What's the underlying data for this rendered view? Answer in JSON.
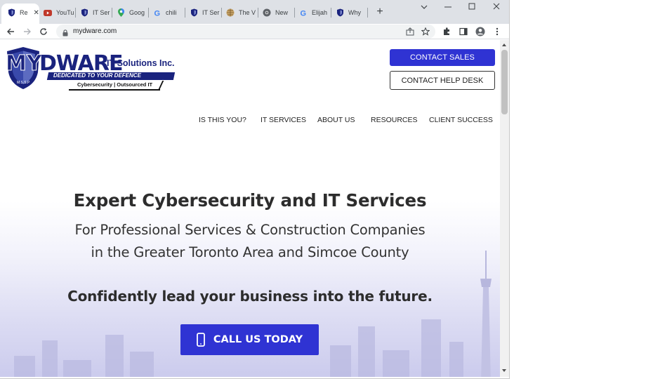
{
  "browser": {
    "tabs": [
      {
        "label": "Re",
        "icon": "shield-favicon"
      },
      {
        "label": "YouTu",
        "icon": "youtube-favicon"
      },
      {
        "label": "IT Ser",
        "icon": "shield-favicon"
      },
      {
        "label": "Goog",
        "icon": "maps-pin-favicon"
      },
      {
        "label": "chili",
        "icon": "google-g-favicon"
      },
      {
        "label": "IT Ser",
        "icon": "shield-favicon"
      },
      {
        "label": "The V",
        "icon": "globe-favicon"
      },
      {
        "label": "New",
        "icon": "chrome-favicon"
      },
      {
        "label": "Elijah",
        "icon": "google-g-favicon"
      },
      {
        "label": "Why",
        "icon": "shield-favicon"
      }
    ],
    "new_tab": "+",
    "url": "mydware.com"
  },
  "site": {
    "logo": {
      "wordmark": "MYDWARE",
      "company": "IT Solutions Inc.",
      "tagline": "DEDICATED TO YOUR DEFENCE",
      "services": "Cybersecurity | Outsourced IT",
      "badge": "M.S.S.P"
    },
    "contact_sales": "CONTACT SALES",
    "contact_help": "CONTACT HELP DESK",
    "nav": [
      "IS THIS YOU?",
      "IT SERVICES",
      "ABOUT US",
      "RESOURCES",
      "CLIENT SUCCESS"
    ],
    "hero": {
      "title": "Expert Cybersecurity and IT Services",
      "subtitle_line1": "For Professional Services & Construction Companies",
      "subtitle_line2": "in the Greater Toronto Area and Simcoe County",
      "tagline": "Confidently lead your business into the future.",
      "cta": "CALL US TODAY"
    }
  },
  "colors": {
    "brand_blue": "#2f33d3",
    "logo_navy": "#1a237e",
    "text_dark": "#2d2d2d"
  }
}
